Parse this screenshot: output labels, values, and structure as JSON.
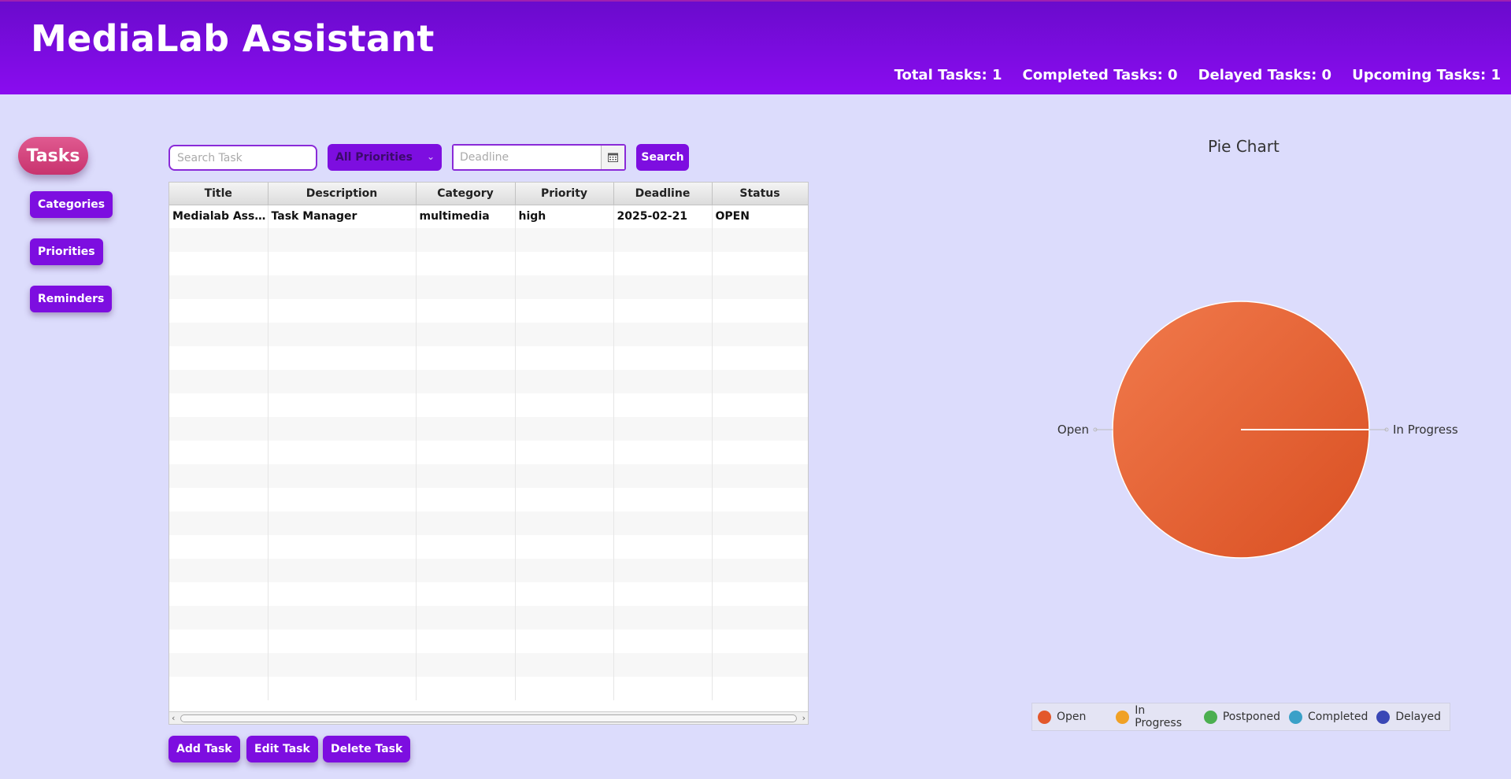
{
  "header": {
    "title": "MediaLab Assistant",
    "stats": [
      {
        "label": "Total Tasks: 1"
      },
      {
        "label": "Completed Tasks: 0"
      },
      {
        "label": "Delayed Tasks: 0"
      },
      {
        "label": "Upcoming Tasks: 1"
      }
    ]
  },
  "sidebar": {
    "active": "Tasks",
    "items": [
      "Categories",
      "Priorities",
      "Reminders"
    ]
  },
  "filters": {
    "search_placeholder": "Search Task",
    "priority_selected": "All Priorities",
    "deadline_placeholder": "Deadline",
    "search_label": "Search"
  },
  "table": {
    "columns": [
      "Title",
      "Description",
      "Category",
      "Priority",
      "Deadline",
      "Status"
    ],
    "rows": [
      [
        "Medialab Assi...",
        "Task Manager",
        "multimedia",
        "high",
        "2025-02-21",
        "OPEN"
      ]
    ]
  },
  "actions": {
    "add": "Add Task",
    "edit": "Edit Task",
    "delete": "Delete Task"
  },
  "chart_data": {
    "type": "pie",
    "title": "Pie Chart",
    "slices": [
      {
        "name": "Open",
        "value": 1,
        "color": "#e3572b"
      },
      {
        "name": "In Progress",
        "value": 0,
        "color": "#f0a125"
      },
      {
        "name": "Postponed",
        "value": 0,
        "color": "#4caf50"
      },
      {
        "name": "Completed",
        "value": 0,
        "color": "#3aa0c8"
      },
      {
        "name": "Delayed",
        "value": 0,
        "color": "#3a47b6"
      }
    ],
    "slice_labels": [
      "Open",
      "In Progress"
    ],
    "legend": [
      "Open",
      "In Progress",
      "Postponed",
      "Completed",
      "Delayed"
    ],
    "legend_position": "bottom-right"
  },
  "colors": {
    "header": "#7a0bdc",
    "button": "#7d0ee0",
    "active_nav": "#d2457e",
    "background": "#dcdcfc"
  }
}
